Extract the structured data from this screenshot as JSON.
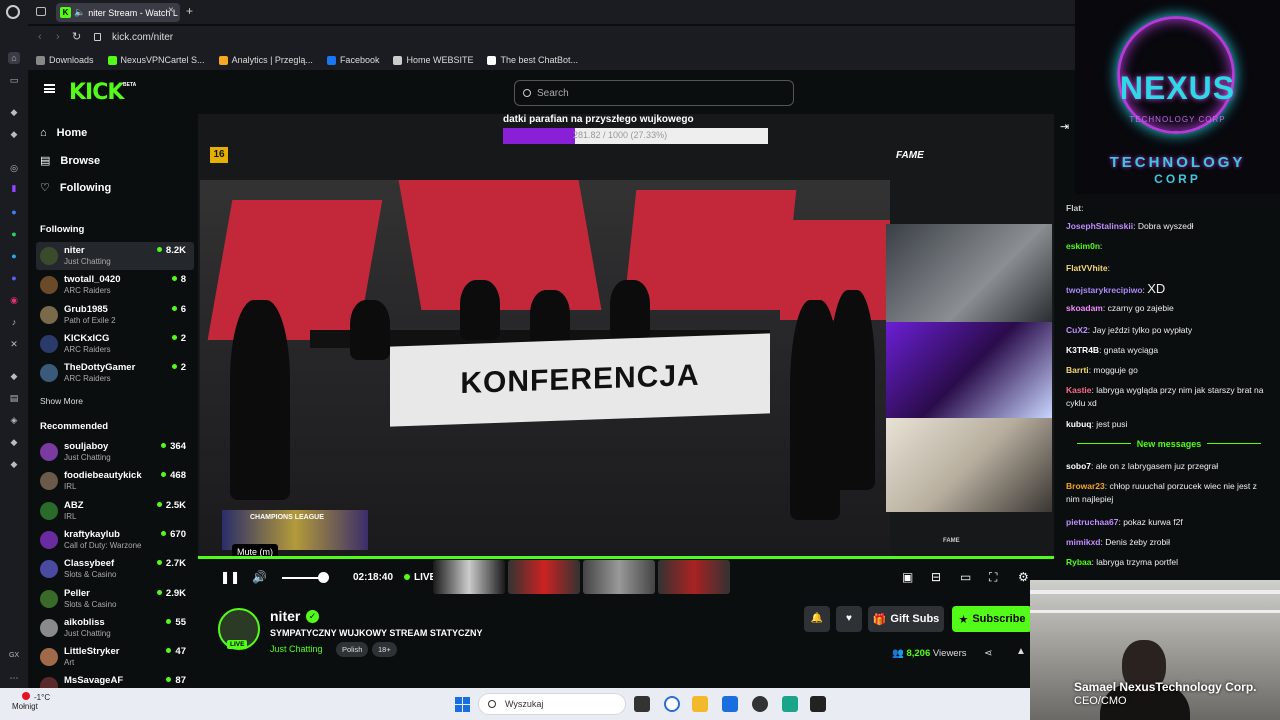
{
  "browser": {
    "tab_title": "niter Stream - Watch L",
    "tab_favicon": "K",
    "url": "kick.com/niter",
    "bookmarks": [
      {
        "label": "Downloads",
        "icon": "download-icon",
        "color": "#888888"
      },
      {
        "label": "NexusVPNCartel S...",
        "icon": "kick-icon",
        "color": "#53fc18"
      },
      {
        "label": "Analytics | Przeglą...",
        "icon": "analytics-icon",
        "color": "#f5a623"
      },
      {
        "label": "Facebook",
        "icon": "facebook-icon",
        "color": "#1877f2"
      },
      {
        "label": "Home WEBSITE",
        "icon": "page-icon",
        "color": "#cccccc"
      },
      {
        "label": "The best ChatBot...",
        "icon": "chatbot-icon",
        "color": "#ffffff"
      }
    ]
  },
  "kick": {
    "logo": "KICK",
    "beta": "BETA",
    "search_placeholder": "Search",
    "accent": "#53fc18"
  },
  "sidebar": {
    "nav": [
      {
        "label": "Home",
        "icon": "home-icon"
      },
      {
        "label": "Browse",
        "icon": "browse-icon"
      },
      {
        "label": "Following",
        "icon": "heart-icon"
      }
    ],
    "following_title": "Following",
    "following": [
      {
        "name": "niter",
        "category": "Just Chatting",
        "viewers": "8.2K"
      },
      {
        "name": "twotall_0420",
        "category": "ARC Raiders",
        "viewers": "8"
      },
      {
        "name": "Grub1985",
        "category": "Path of Exile 2",
        "viewers": "6"
      },
      {
        "name": "KICKxICG",
        "category": "ARC Raiders",
        "viewers": "2"
      },
      {
        "name": "TheDottyGamer",
        "category": "ARC Raiders",
        "viewers": "2"
      }
    ],
    "show_more": "Show More",
    "recommended_title": "Recommended",
    "recommended": [
      {
        "name": "souljaboy",
        "category": "Just Chatting",
        "viewers": "364"
      },
      {
        "name": "foodiebeautykick",
        "category": "IRL",
        "viewers": "468"
      },
      {
        "name": "ABZ",
        "category": "IRL",
        "viewers": "2.5K"
      },
      {
        "name": "kraftykaylub",
        "category": "Call of Duty: Warzone",
        "viewers": "670"
      },
      {
        "name": "Classybeef",
        "category": "Slots & Casino",
        "viewers": "2.7K"
      },
      {
        "name": "Peller",
        "category": "Slots & Casino",
        "viewers": "2.9K"
      },
      {
        "name": "aikobliss",
        "category": "Just Chatting",
        "viewers": "55"
      },
      {
        "name": "LittleStryker",
        "category": "Art",
        "viewers": "47"
      },
      {
        "name": "MsSavageAF",
        "category": "",
        "viewers": "87"
      }
    ]
  },
  "video": {
    "overlay_title": "datki parafian na przyszłego wujkowego",
    "overlay_progress_text": "281.82 / 1000 (27.33%)",
    "overlay_progress": 0.2733,
    "age_badge": "16",
    "brand": "FAME",
    "banner": "KONFERENCJA",
    "league": "CHAMPIONS LEAGUE",
    "tooltip": "Mute (m)",
    "time": "02:18:40",
    "live": "LIVE",
    "volume": 0.8
  },
  "stream": {
    "name": "niter",
    "live_badge": "LIVE",
    "title": "SYMPATYCZNY WUJKOWY STREAM STATYCZNY",
    "category": "Just Chatting",
    "tags": [
      "Polish",
      "18+"
    ],
    "gift_label": "Gift Subs",
    "subscribe_label": "Subscribe",
    "viewers": "8,206",
    "viewers_label": "Viewers"
  },
  "chat": {
    "new_messages": "New messages",
    "messages": [
      {
        "user": "Flat",
        "color": "#c9c9c9",
        "text": ""
      },
      {
        "user": "JosephStalinskii",
        "color": "#c08cff",
        "text": "Dobra wyszedł"
      },
      {
        "user": "eskim0n",
        "color": "#53fc18",
        "text": ""
      },
      {
        "user": "FlatVVhite",
        "color": "#f5d76e",
        "text": ""
      },
      {
        "user": "twojstarykrecipiwo",
        "color": "#a78bfa",
        "text": "XD"
      },
      {
        "user": "skoadam",
        "color": "#f08cff",
        "text": "czarny go zajebie"
      },
      {
        "user": "CuX2",
        "color": "#c08cff",
        "text": "Jay jeździ tylko po wypłaty"
      },
      {
        "user": "K3TR4B",
        "color": "#ffffff",
        "text": "gnata wyciąga"
      },
      {
        "user": "Barrti",
        "color": "#f5d76e",
        "text": "mogguje go"
      },
      {
        "user": "Kastie",
        "color": "#ff6b8a",
        "text": "labryga wygląda przy nim jak starszy brat na cyklu xd"
      },
      {
        "user": "kubuq",
        "color": "#ffffff",
        "text": "jest pusi"
      },
      {
        "user": "sobo7",
        "color": "#ffffff",
        "text": "ale on z labrygasem juz przegrał"
      },
      {
        "user": "Browar23",
        "color": "#f5a623",
        "text": "chłop ruuuchal porzucek wiec nie jest z nim najlepiej"
      },
      {
        "user": "pietruchaa67",
        "color": "#c08cff",
        "text": "pokaz kurwa f2f"
      },
      {
        "user": "mimikxd",
        "color": "#c08cff",
        "text": "Denis żeby zrobił"
      },
      {
        "user": "Rybaa",
        "color": "#53fc18",
        "text": "labryga trzyma portfel"
      }
    ]
  },
  "overlay_nexus": {
    "line1": "NEXUS",
    "line2": "TECHNOLOGY CORP",
    "line3": "TECHNOLOGY",
    "line4": "CORP"
  },
  "webcam": {
    "name": "Samael NexusTechnology Corp.",
    "role": "CEO/CMO"
  },
  "taskbar": {
    "temp": "-1°C",
    "weather": "Mołnigt",
    "search": "Wyszukaj"
  }
}
